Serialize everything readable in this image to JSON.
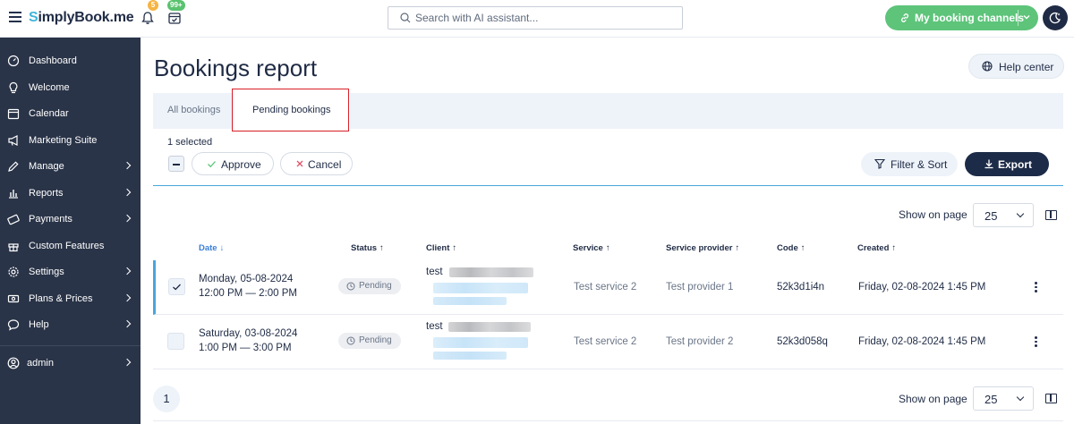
{
  "topbar": {
    "logo": "SimplyBook.me",
    "logo_first": "S",
    "logo_rest": "implyBook.me",
    "notifications_count": "5",
    "bookings_count": "99+",
    "search_placeholder": "Search with AI assistant...",
    "channels_label": "My booking channels",
    "accent": "#5dc47a"
  },
  "sidebar": {
    "items": [
      {
        "label": "Dashboard",
        "icon": "dashboard-gauge-icon",
        "arrow": false
      },
      {
        "label": "Welcome",
        "icon": "lightbulb-icon",
        "arrow": false
      },
      {
        "label": "Calendar",
        "icon": "calendar-icon",
        "arrow": false
      },
      {
        "label": "Marketing Suite",
        "icon": "megaphone-icon",
        "arrow": false
      },
      {
        "label": "Manage",
        "icon": "pencil-icon",
        "arrow": true
      },
      {
        "label": "Reports",
        "icon": "bar-chart-icon",
        "arrow": true
      },
      {
        "label": "Payments",
        "icon": "credit-card-icon",
        "arrow": true
      },
      {
        "label": "Custom Features",
        "icon": "gift-icon",
        "arrow": false
      },
      {
        "label": "Settings",
        "icon": "gear-icon",
        "arrow": true
      },
      {
        "label": "Plans & Prices",
        "icon": "money-icon",
        "arrow": true
      },
      {
        "label": "Help",
        "icon": "chat-bubble-icon",
        "arrow": true
      }
    ],
    "user": "admin"
  },
  "page": {
    "title": "Bookings report",
    "help_label": "Help center"
  },
  "tabs": {
    "all": "All bookings",
    "pending": "Pending bookings"
  },
  "toolbar": {
    "selected": "1 selected",
    "approve": "Approve",
    "cancel": "Cancel",
    "filter": "Filter & Sort",
    "export": "Export"
  },
  "pagination": {
    "show_label": "Show on page",
    "page_size": "25",
    "current_page": "1"
  },
  "table": {
    "headers": {
      "date": "Date",
      "status": "Status",
      "client": "Client",
      "service": "Service",
      "provider": "Service provider",
      "code": "Code",
      "created": "Created"
    },
    "sort_arrow_down": "↓",
    "sort_arrow_up": "↑",
    "rows": [
      {
        "selected": true,
        "date": "Monday, 05-08-2024",
        "time": "12:00 PM — 2:00 PM",
        "status": "Pending",
        "client": "test",
        "service": "Test service 2",
        "provider": "Test provider 1",
        "code": "52k3d1i4n",
        "created": "Friday, 02-08-2024 1:45 PM"
      },
      {
        "selected": false,
        "date": "Saturday, 03-08-2024",
        "time": "1:00 PM — 3:00 PM",
        "status": "Pending",
        "client": "test",
        "service": "Test service 2",
        "provider": "Test provider 2",
        "code": "52k3d058q",
        "created": "Friday, 02-08-2024 1:45 PM"
      }
    ]
  }
}
